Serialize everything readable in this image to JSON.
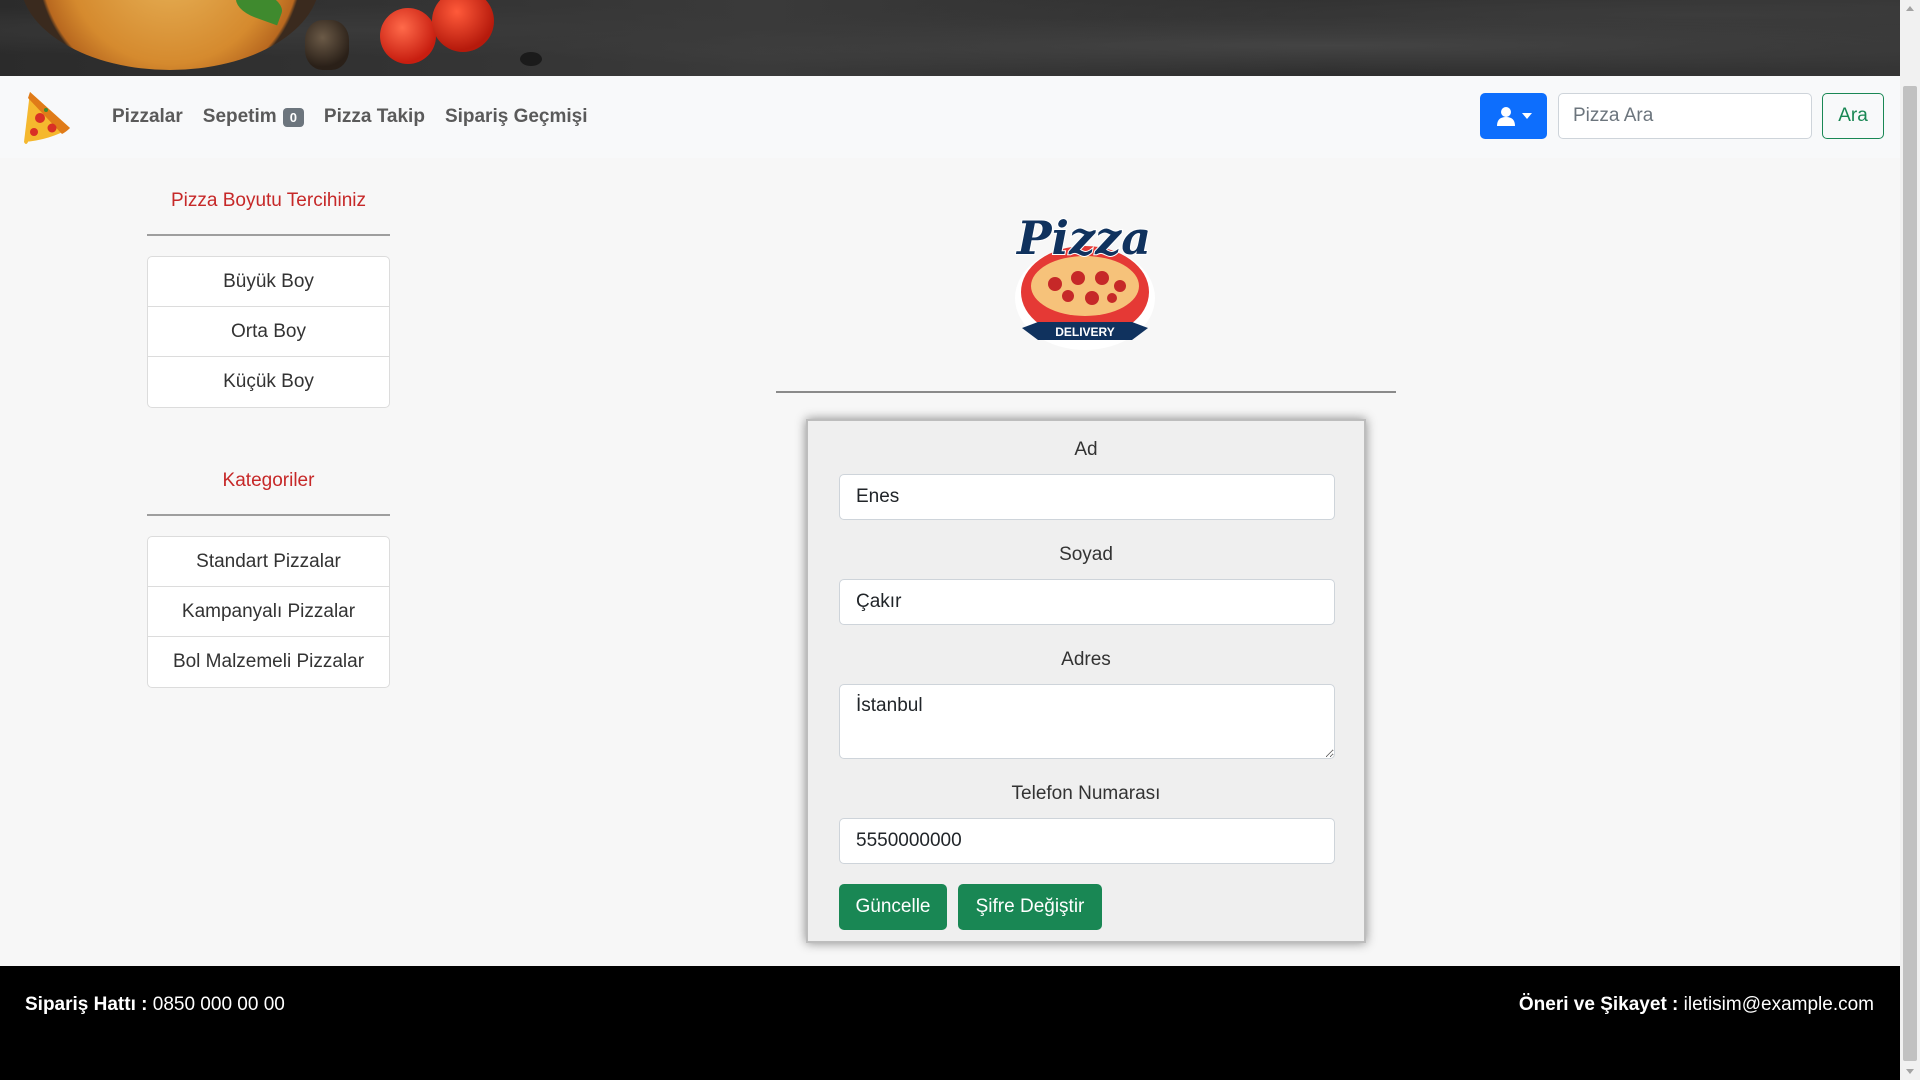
{
  "navbar": {
    "links": [
      {
        "label": "Pizzalar"
      },
      {
        "label": "Sepetim",
        "badge": "0"
      },
      {
        "label": "Pizza Takip"
      },
      {
        "label": "Sipariş Geçmişi"
      }
    ],
    "search_placeholder": "Pizza Ara",
    "search_button": "Ara",
    "user_icon": "user-icon",
    "accent_color": "#0d6efd"
  },
  "sidebar": {
    "size_heading": "Pizza Boyutu Tercihiniz",
    "sizes": [
      "Büyük Boy",
      "Orta Boy",
      "Küçük Boy"
    ],
    "category_heading": "Kategoriler",
    "categories": [
      "Standart Pizzalar",
      "Kampanyalı Pizzalar",
      "Bol Malzemeli Pizzalar"
    ],
    "heading_color": "#c62828"
  },
  "logo": {
    "title": "Pizza",
    "ribbon": "DELIVERY"
  },
  "form": {
    "name_label": "Ad",
    "name_value": "Enes",
    "surname_label": "Soyad",
    "surname_value": "Çakır",
    "address_label": "Adres",
    "address_value": "İstanbul",
    "phone_label": "Telefon Numarası",
    "phone_value": "5550000000",
    "update_button": "Güncelle",
    "password_button": "Şifre Değiştir",
    "button_color": "#198754"
  },
  "footer": {
    "left_label": "Sipariş Hattı :",
    "left_value": "0850 000 00 00",
    "right_label": "Öneri ve Şikayet :",
    "right_value": "iletisim@example.com"
  }
}
